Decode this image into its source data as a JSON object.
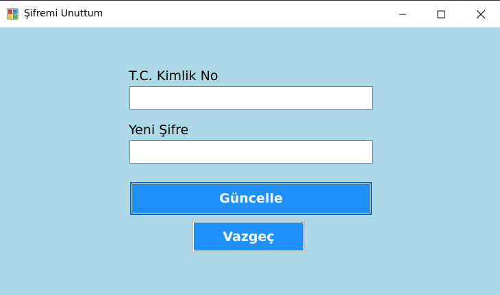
{
  "window": {
    "title": "Şifremi Unuttum",
    "icon": "app-form-icon",
    "controls": {
      "minimize_icon": "minimize-icon",
      "maximize_icon": "maximize-icon",
      "close_icon": "close-icon"
    }
  },
  "form": {
    "background_color": "#add8e6",
    "tc_label": "T.C. Kimlik No",
    "tc_value": "",
    "password_label": "Yeni Şifre",
    "password_value": "",
    "update_button": "Güncelle",
    "cancel_button": "Vazgeç",
    "button_color": "#1e90ff"
  }
}
